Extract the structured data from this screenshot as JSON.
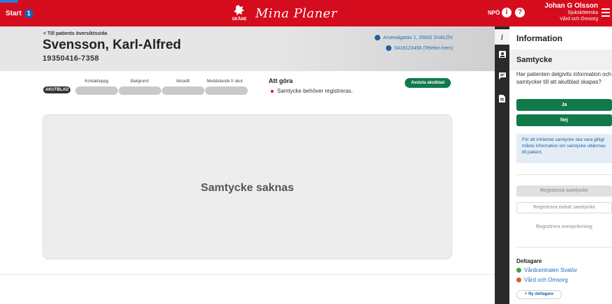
{
  "topbar": {
    "start_label": "Start",
    "start_count": "1",
    "brand_logo_text": "SKÅNE",
    "brand_title": "Mina Planer",
    "npo_label": "NPÖ",
    "info_glyph": "i",
    "help_glyph": "?",
    "user_name": "Johan G Olsson",
    "user_role": "Sjuksköterska",
    "user_unit": "Vård och Omsorg"
  },
  "patient": {
    "back_link": "< Till patients översiktssida",
    "name": "Svensson, Karl-Alfred",
    "personal_id": "19350416-7358",
    "address": "Arsenalgatan 1, 26832 SVALÖV",
    "phone": "0418123456 (Telefon hem)"
  },
  "progress": {
    "badge": "AKUTBLAD",
    "steps": [
      "Kontaktuppg.",
      "Bakgrund",
      "Aktuellt",
      "Meddelande fr akut"
    ]
  },
  "todo": {
    "title": "Att göra",
    "items": [
      "Samtycke behöver registreras."
    ],
    "close_button": "Avsluta akutblad"
  },
  "main": {
    "message": "Samtycke saknas"
  },
  "rail": {
    "active_glyph": "i",
    "icons": [
      "info-icon",
      "person-badge-icon",
      "comment-icon",
      "document-icon"
    ]
  },
  "panel": {
    "title": "Information",
    "section_title": "Samtycke",
    "question": "Har patienten delgivits information och samtycker till att akutblad skapas?",
    "yes_label": "Ja",
    "no_label": "Nej",
    "info_text": "För att inhämtat samtycke ska vara giltigt måste information om samtycke utlämnas till patient.",
    "register_consent": "Registrera samtycke",
    "register_refusal": "Registrera nekat samtycke",
    "register_trial": "Registrera menprövning",
    "participants_title": "Deltagare",
    "participants": [
      {
        "name": "Vårdcentralen Svalöv",
        "status_color": "#3aa545"
      },
      {
        "name": "Vård och Omsorg",
        "status_color": "#e2572b"
      }
    ],
    "add_participant": "+ Ny deltagare"
  },
  "colors": {
    "brand_red": "#d50c1e",
    "action_green": "#127a4a",
    "link_blue": "#1c6ec2"
  }
}
